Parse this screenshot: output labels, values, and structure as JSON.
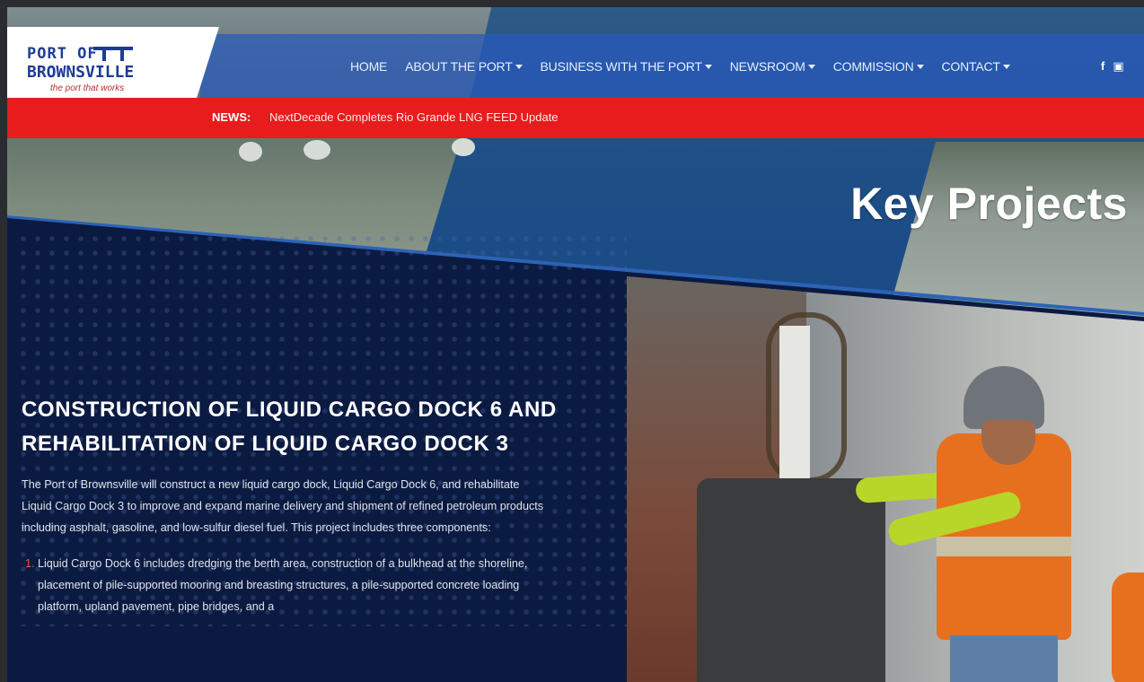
{
  "logo": {
    "line1": "PORT OF",
    "line2": "BROWNSVILLE",
    "tagline": "the port that works"
  },
  "nav": {
    "items": [
      {
        "label": "HOME",
        "dropdown": false
      },
      {
        "label": "ABOUT THE PORT",
        "dropdown": true
      },
      {
        "label": "BUSINESS WITH THE PORT",
        "dropdown": true
      },
      {
        "label": "NEWSROOM",
        "dropdown": true
      },
      {
        "label": "COMMISSION",
        "dropdown": true
      },
      {
        "label": "CONTACT",
        "dropdown": true
      }
    ],
    "social": {
      "facebook": "f",
      "youtube": "▣"
    }
  },
  "news": {
    "label": "NEWS:",
    "headline": "NextDecade Completes Rio Grande LNG FEED Update"
  },
  "hero": {
    "title": "Key Projects"
  },
  "article": {
    "title": "CONSTRUCTION OF LIQUID CARGO DOCK 6 AND REHABILITATION OF LIQUID CARGO DOCK 3",
    "intro": "The Port of Brownsville will construct a new liquid cargo dock, Liquid Cargo Dock 6, and rehabilitate Liquid Cargo Dock 3 to improve and expand marine delivery and shipment of refined petroleum products including asphalt, gasoline, and low-sulfur diesel fuel. This project includes three components:",
    "list": [
      {
        "num": "1.",
        "text": "Liquid Cargo Dock 6 includes dredging the berth area, construction of a bulkhead at the shoreline, placement of pile-supported mooring and breasting structures, a pile-supported concrete loading platform, upland pavement, pipe bridges, and a"
      }
    ]
  },
  "colors": {
    "accent_red": "#e81c1c",
    "navy": "#0b1a40",
    "logo_blue": "#1d3b96",
    "nav_overlay": "#2b63b8"
  }
}
